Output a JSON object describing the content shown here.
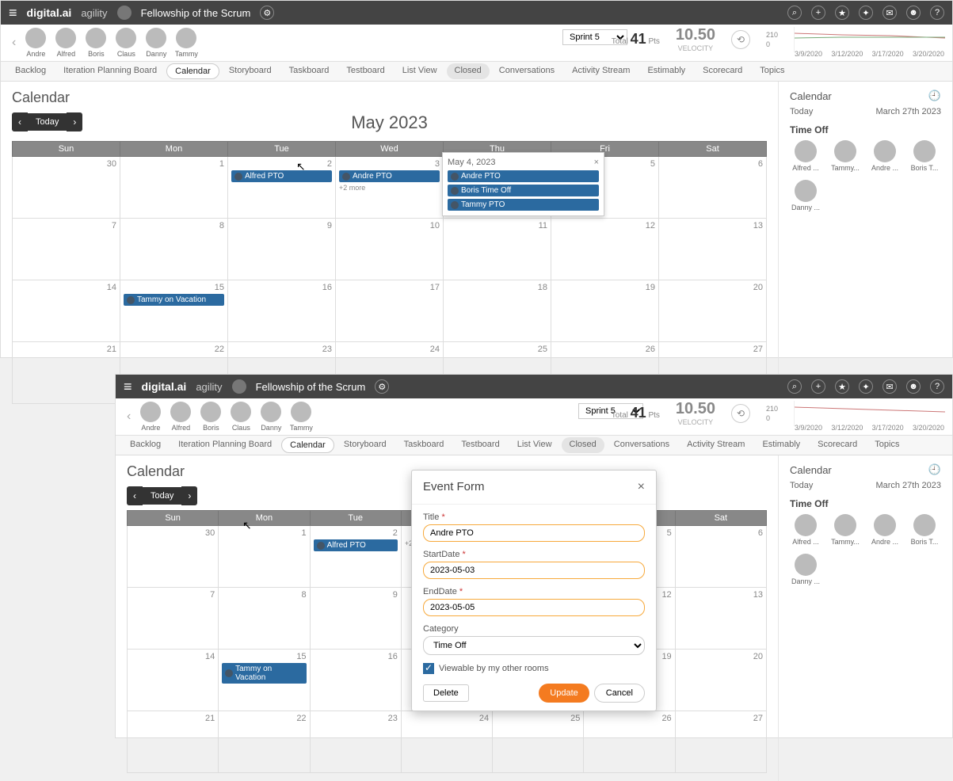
{
  "brand_primary": "digital.ai",
  "brand_secondary": "agility",
  "room_name": "Fellowship of the Scrum",
  "header_icons": [
    "search-icon",
    "plus-icon",
    "star-icon",
    "puzzle-icon",
    "chat-icon",
    "user-icon",
    "help-icon"
  ],
  "members": [
    {
      "name": "Andre"
    },
    {
      "name": "Alfred"
    },
    {
      "name": "Boris"
    },
    {
      "name": "Claus"
    },
    {
      "name": "Danny"
    },
    {
      "name": "Tammy"
    }
  ],
  "sprint_selected": "Sprint 5",
  "total_label": "Total",
  "total_value": "41",
  "total_unit": "Pts",
  "velocity_value": "10.50",
  "velocity_label": "VELOCITY",
  "mini_top": "210",
  "mini_bottom": "0",
  "spark_dates": [
    "3/9/2020",
    "3/12/2020",
    "3/17/2020",
    "3/20/2020"
  ],
  "tabs": [
    "Backlog",
    "Iteration Planning Board",
    "Calendar",
    "Storyboard",
    "Taskboard",
    "Testboard",
    "List View",
    "Closed",
    "Conversations",
    "Activity Stream",
    "Estimably",
    "Scorecard",
    "Topics"
  ],
  "active_tab": "Calendar",
  "page_title": "Calendar",
  "calnav_today": "Today",
  "cal_title": "May 2023",
  "dow": [
    "Sun",
    "Mon",
    "Tue",
    "Wed",
    "Thu",
    "Fri",
    "Sat"
  ],
  "weeks": [
    [
      "30",
      "1",
      "2",
      "3",
      "4",
      "5",
      "6"
    ],
    [
      "7",
      "8",
      "9",
      "10",
      "11",
      "12",
      "13"
    ],
    [
      "14",
      "15",
      "16",
      "17",
      "18",
      "19",
      "20"
    ],
    [
      "21",
      "22",
      "23",
      "24",
      "25",
      "26",
      "27"
    ]
  ],
  "events": {
    "row0": {
      "tue": "Alfred PTO",
      "wed": "Andre PTO",
      "wed_more": "+2 more"
    },
    "row2": {
      "mon": "Tammy on Vacation"
    }
  },
  "popover": {
    "date": "May 4, 2023",
    "items": [
      "Andre PTO",
      "Boris Time Off",
      "Tammy PTO"
    ]
  },
  "side": {
    "title": "Calendar",
    "today_label": "Today",
    "today_value": "March 27th 2023",
    "section": "Time Off",
    "people": [
      "Alfred ...",
      "Tammy...",
      "Andre ...",
      "Boris T...",
      "Danny ..."
    ]
  },
  "modal": {
    "title": "Event Form",
    "fields": {
      "title_label": "Title",
      "title_value": "Andre PTO",
      "start_label": "StartDate",
      "start_value": "2023-05-03",
      "end_label": "EndDate",
      "end_value": "2023-05-05",
      "cat_label": "Category",
      "cat_value": "Time Off"
    },
    "checkbox": "Viewable by my other rooms",
    "delete": "Delete",
    "update": "Update",
    "cancel": "Cancel"
  }
}
